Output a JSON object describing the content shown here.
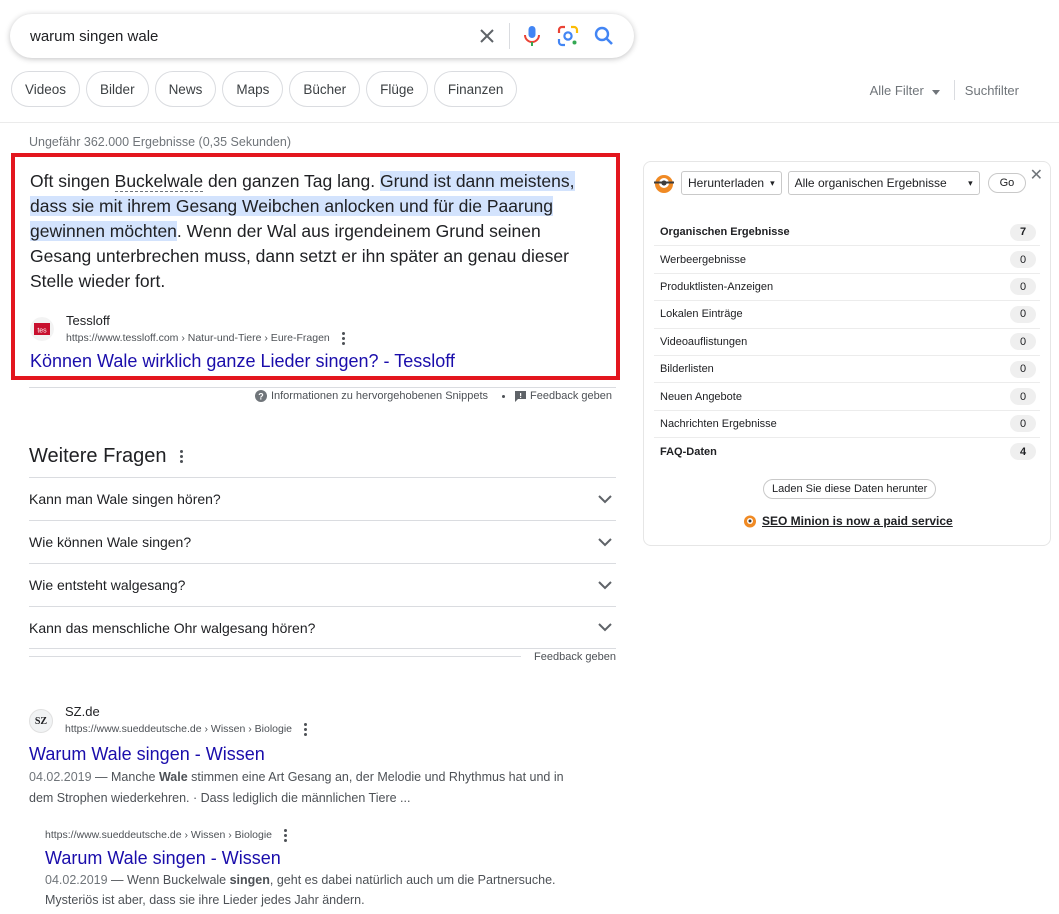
{
  "search": {
    "query": "warum singen wale"
  },
  "chips": [
    "Videos",
    "Bilder",
    "News",
    "Maps",
    "Bücher",
    "Flüge",
    "Finanzen"
  ],
  "filters": {
    "all_filters": "Alle Filter",
    "search_filters": "Suchfilter"
  },
  "result_stats": "Ungefähr 362.000 Ergebnisse (0,35 Sekunden)",
  "snippet": {
    "text_1": "Oft singen ",
    "text_dotted": "Buckelwale",
    "text_2": " den ganzen Tag lang. ",
    "text_highlight": "Grund ist dann meistens, dass sie mit ihrem Gesang Weibchen anlocken und für die Paarung gewinnen möchten",
    "text_3": ". Wenn der Wal aus irgendeinem Grund seinen Gesang unterbrechen muss, dann setzt er ihn später an genau dieser Stelle wieder fort.",
    "source_name": "Tessloff",
    "source_url": "https://www.tessloff.com › Natur-und-Tiere › Eure-Fragen",
    "title": "Können Wale wirklich ganze Lieder singen? - Tessloff",
    "favicon_text": "tes",
    "info": "Informationen zu hervorgehobenen Snippets",
    "feedback": "Feedback geben"
  },
  "paa": {
    "title": "Weitere Fragen",
    "questions": [
      "Kann man Wale singen hören?",
      "Wie können Wale singen?",
      "Wie entsteht walgesang?",
      "Kann das menschliche Ohr walgesang hören?"
    ],
    "feedback": "Feedback geben"
  },
  "results": [
    {
      "favicon_text": "SZ",
      "site": "SZ.de",
      "url": "https://www.sueddeutsche.de › Wissen › Biologie",
      "title": "Warum Wale singen - Wissen",
      "date": "04.02.2019",
      "snippet_a": " — Manche ",
      "snippet_bold": "Wale",
      "snippet_b": " stimmen eine Art Gesang an, der Melodie und Rhythmus hat und in dem Strophen wiederkehren. · Dass lediglich die männlichen Tiere ..."
    },
    {
      "url": "https://www.sueddeutsche.de › Wissen › Biologie",
      "title": "Warum Wale singen - Wissen",
      "date": "04.02.2019",
      "snippet_a": " — Wenn Buckelwale ",
      "snippet_bold": "singen",
      "snippet_b": ", geht es dabei natürlich auch um die Partnersuche. Mysteriös ist aber, dass sie ihre Lieder jedes Jahr ändern."
    }
  ],
  "widget": {
    "download_select": "Herunterladen",
    "results_select": "Alle organischen Ergebnisse",
    "go": "Go",
    "rows": [
      {
        "label": "Organischen Ergebnisse",
        "count": "7"
      },
      {
        "label": "Werbeergebnisse",
        "count": "0"
      },
      {
        "label": "Produktlisten-Anzeigen",
        "count": "0"
      },
      {
        "label": "Lokalen Einträge",
        "count": "0"
      },
      {
        "label": "Videoauflistungen",
        "count": "0"
      },
      {
        "label": "Bilderlisten",
        "count": "0"
      },
      {
        "label": "Neuen Angebote",
        "count": "0"
      },
      {
        "label": "Nachrichten Ergebnisse",
        "count": "0"
      },
      {
        "label": "FAQ-Daten",
        "count": "4"
      }
    ],
    "download_button": "Laden Sie diese Daten herunter",
    "paid_notice": "SEO Minion is now a paid service"
  },
  "colors": {
    "link": "#1a0dab",
    "highlight": "#d3e3fd",
    "snippet_border": "#e3161e",
    "minion": "#f08a24"
  }
}
